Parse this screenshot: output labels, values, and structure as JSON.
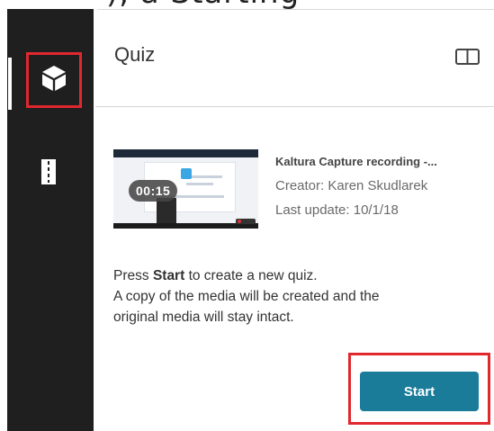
{
  "header": {
    "partial_text": "), a Starting"
  },
  "sidebar": {
    "items": [
      {
        "id": "quiz",
        "icon": "cube-icon",
        "active": true
      },
      {
        "id": "chapters",
        "icon": "chapters-icon",
        "active": false
      }
    ]
  },
  "panel": {
    "title": "Quiz",
    "layout_icon": "panel-layout-icon"
  },
  "entry": {
    "duration": "00:15",
    "title": "Kaltura Capture recording -...",
    "creator": "Creator: Karen Skudlarek",
    "last_update": "Last update: 10/1/18"
  },
  "description": {
    "line1_prefix": "Press ",
    "line1_bold": "Start",
    "line1_suffix": " to create a new quiz.",
    "line2": "A copy of the media will be created and the",
    "line3": "original media will stay intact."
  },
  "actions": {
    "start_label": "Start"
  },
  "colors": {
    "sidebar_bg": "#1f1f1f",
    "highlight": "#e0282e",
    "primary_button": "#1b7c9a"
  }
}
